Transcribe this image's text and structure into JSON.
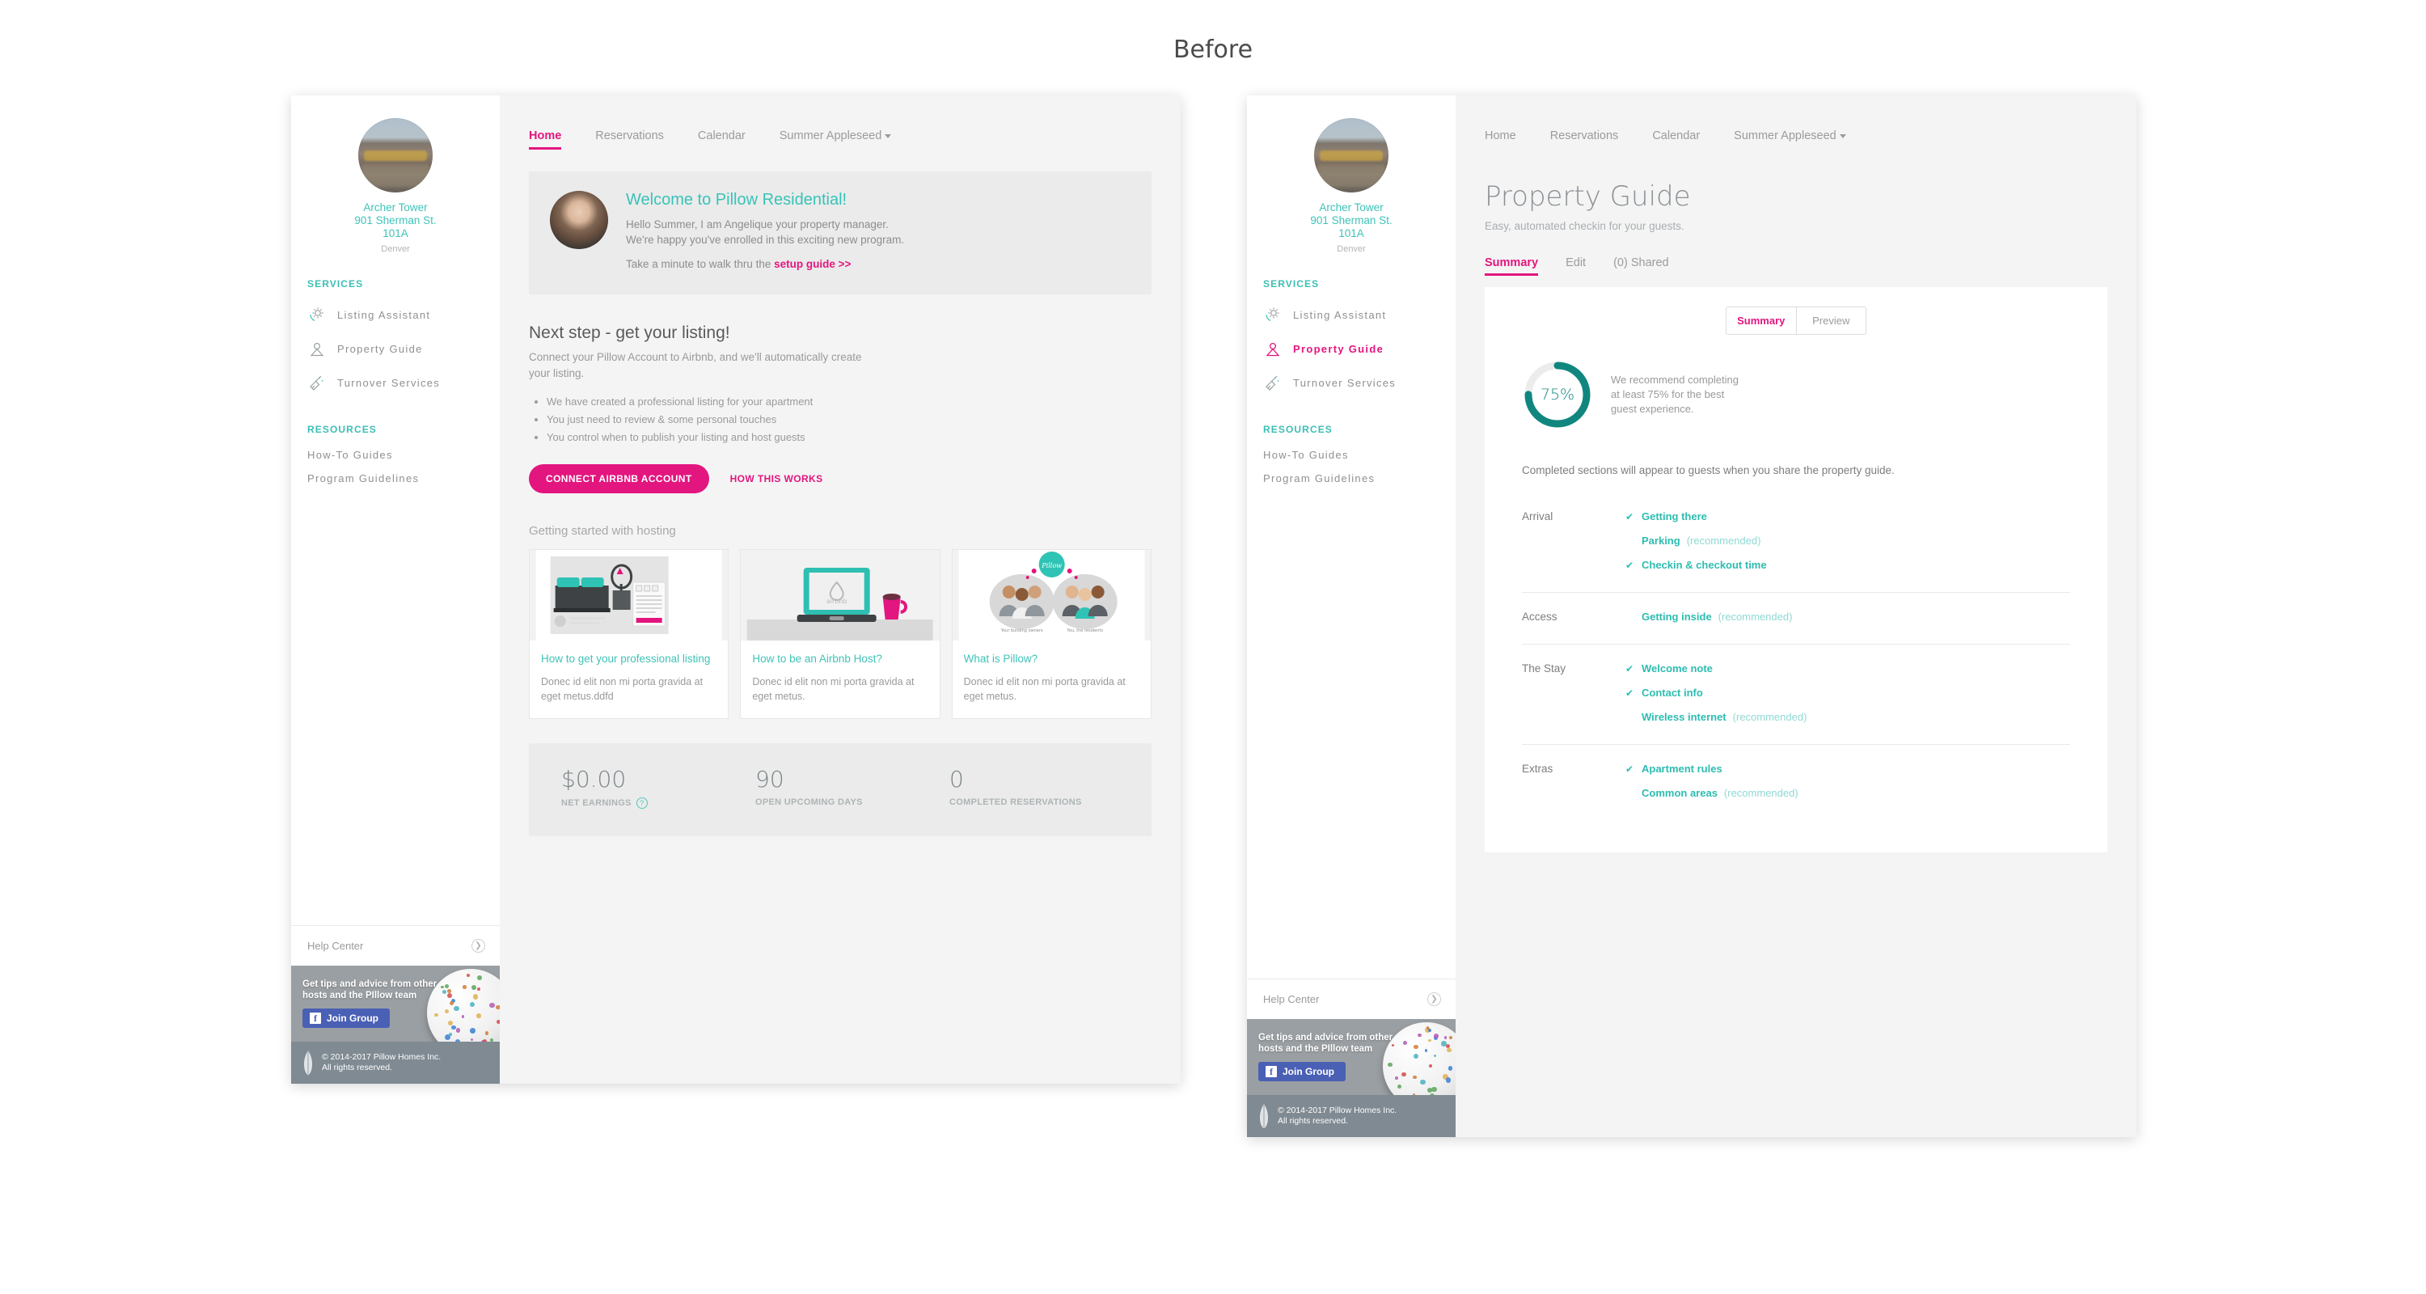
{
  "caption": "Before",
  "accent_pink": "#e3157f",
  "accent_teal": "#2dbdb1",
  "accent_teal_dark": "#11867e",
  "property": {
    "name_line1": "Archer Tower",
    "name_line2": "901 Sherman St.",
    "name_line3": "101A",
    "city": "Denver"
  },
  "sidebar": {
    "services_heading": "SERVICES",
    "services": [
      {
        "label": "Listing Assistant",
        "icon": "gear-icon"
      },
      {
        "label": "Property Guide",
        "icon": "map-pin-icon"
      },
      {
        "label": "Turnover Services",
        "icon": "broom-icon"
      }
    ],
    "resources_heading": "RESOURCES",
    "resources": [
      {
        "label": "How-To Guides"
      },
      {
        "label": "Program Guidelines"
      }
    ],
    "help_center": "Help Center",
    "promo": {
      "text": "Get tips and advice from other hosts and the PIllow team",
      "button": "Join Group",
      "icon": "facebook-icon"
    },
    "copyright_line1": "© 2014-2017 Pillow Homes Inc.",
    "copyright_line2": "All rights reserved."
  },
  "topnav": {
    "items": [
      {
        "label": "Home"
      },
      {
        "label": "Reservations"
      },
      {
        "label": "Calendar"
      },
      {
        "label": "Summer Appleseed"
      }
    ]
  },
  "home": {
    "welcome": {
      "title": "Welcome to Pillow Residential!",
      "line1": "Hello Summer, I am Angelique your property manager.",
      "line2": "We're happy you've enrolled in this exciting new program.",
      "foot_prefix": "Take a minute to walk thru the ",
      "foot_link": "setup guide >>"
    },
    "next_step": {
      "title": "Next step - get your listing!",
      "lead": "Connect your Pillow Account to Airbnb, and we'll automatically create your listing.",
      "bullets": [
        "We have created a professional listing for your apartment",
        "You just need to review & some personal touches",
        "You control when to publish your listing and host guests"
      ],
      "primary_button": "CONNECT AIRBNB ACCOUNT",
      "secondary_link": "HOW THIS WORKS"
    },
    "cards_heading": "Getting started with hosting",
    "cards": [
      {
        "title": "How to get your professional listing",
        "desc": "Donec id elit non mi porta gravida at eget metus.ddfd",
        "thumb": "bedroom-illustration"
      },
      {
        "title": "How to be an Airbnb Host?",
        "desc": "Donec id elit non mi porta gravida at eget metus.",
        "thumb": "laptop-airbnb-illustration"
      },
      {
        "title": "What is Pillow?",
        "desc": "Donec id elit non mi porta gravida at eget metus.",
        "thumb": "people-pillow-illustration"
      }
    ],
    "stats": [
      {
        "value": "$0.00",
        "label": "NET EARNINGS",
        "has_help": true
      },
      {
        "value": "90",
        "label": "OPEN UPCOMING DAYS",
        "has_help": false
      },
      {
        "value": "0",
        "label": "COMPLETED RESERVATIONS",
        "has_help": false
      }
    ]
  },
  "guide": {
    "title": "Property Guide",
    "subtitle": "Easy, automated checkin for your guests.",
    "tabs": [
      {
        "label": "Summary"
      },
      {
        "label": "Edit"
      },
      {
        "label": "(0) Shared"
      }
    ],
    "segmented": [
      {
        "label": "Summary"
      },
      {
        "label": "Preview"
      }
    ],
    "progress": {
      "percent_label": "75%",
      "percent_value": 75,
      "note_line1": "We recommend completing",
      "note_line2": "at least 75% for the best",
      "note_line3": "guest experience."
    },
    "note": "Completed sections will appear to guests when you share the property guide.",
    "sections": [
      {
        "name": "Arrival",
        "items": [
          {
            "label": "Getting there",
            "done": true,
            "recommended": ""
          },
          {
            "label": "Parking",
            "done": false,
            "recommended": "(recommended)"
          },
          {
            "label": "Checkin & checkout time",
            "done": true,
            "recommended": ""
          }
        ]
      },
      {
        "name": "Access",
        "items": [
          {
            "label": "Getting inside",
            "done": false,
            "recommended": "(recommended)"
          }
        ]
      },
      {
        "name": "The Stay",
        "items": [
          {
            "label": "Welcome note",
            "done": true,
            "recommended": ""
          },
          {
            "label": "Contact info",
            "done": true,
            "recommended": ""
          },
          {
            "label": "Wireless internet",
            "done": false,
            "recommended": "(recommended)"
          }
        ]
      },
      {
        "name": "Extras",
        "items": [
          {
            "label": "Apartment rules",
            "done": true,
            "recommended": ""
          },
          {
            "label": "Common areas",
            "done": false,
            "recommended": "(recommended)"
          }
        ]
      }
    ]
  }
}
